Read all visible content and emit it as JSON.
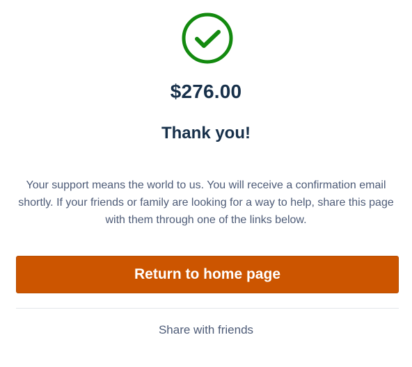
{
  "confirmation": {
    "icon": "check-circle-icon",
    "icon_color": "#138a0f",
    "amount": "$276.00",
    "heading": "Thank you!",
    "message": "Your support means the world to us. You will receive a confirmation email shortly. If your friends or family are looking for a way to help, share this page with them through one of the links below."
  },
  "actions": {
    "home_button_label": "Return to home page",
    "home_button_color": "#cc5500",
    "share_label": "Share with friends"
  }
}
